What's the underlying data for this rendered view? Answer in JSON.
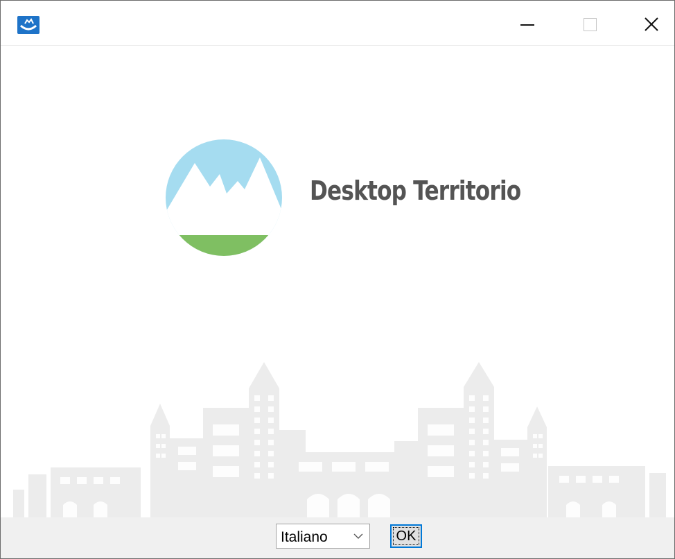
{
  "window": {
    "app_icon": "desktop-territorio-app-icon",
    "controls": {
      "minimize_icon": "minimize-icon",
      "maximize_icon": "maximize-icon",
      "close_icon": "close-icon"
    }
  },
  "splash": {
    "brand_title": "Desktop Territorio",
    "logo_icon": "mountain-logo-icon",
    "colors": {
      "sky": "#a5dcf0",
      "grass": "#7fbf62",
      "title": "#545454",
      "skyline": "#ececec",
      "accent": "#0078d7"
    }
  },
  "footer": {
    "language_select": {
      "value": "Italiano",
      "arrow_icon": "chevron-down-icon"
    },
    "ok_label": "OK"
  }
}
